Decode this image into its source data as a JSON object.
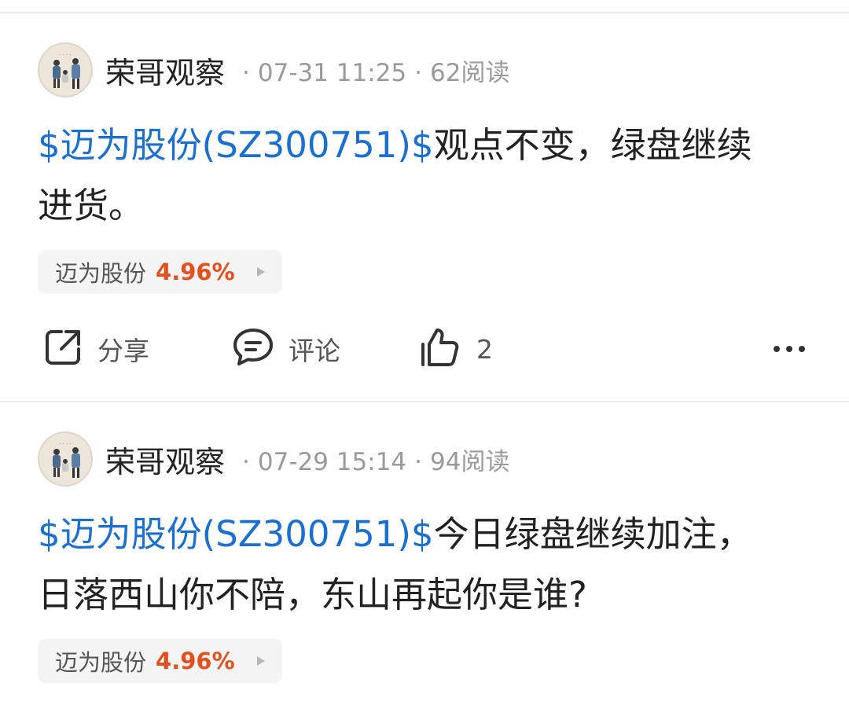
{
  "colors": {
    "stock_link": "#1a6fd0",
    "gain": "#e2501c",
    "divider": "#ececec"
  },
  "posts": [
    {
      "author": "荣哥观察",
      "date": "07-31 11:25",
      "reads": "62阅读",
      "stock_link": "$迈为股份(SZ300751)$",
      "text": "观点不变，绿盘继续进货。",
      "tag": {
        "name": "迈为股份",
        "change": "4.96%"
      },
      "actions": {
        "share": "分享",
        "comment": "评论",
        "like_count": "2"
      }
    },
    {
      "author": "荣哥观察",
      "date": "07-29 15:14",
      "reads": "94阅读",
      "stock_link": "$迈为股份(SZ300751)$",
      "text": "今日绿盘继续加注，日落西山你不陪，东山再起你是谁?",
      "tag": {
        "name": "迈为股份",
        "change": "4.96%"
      }
    }
  ]
}
